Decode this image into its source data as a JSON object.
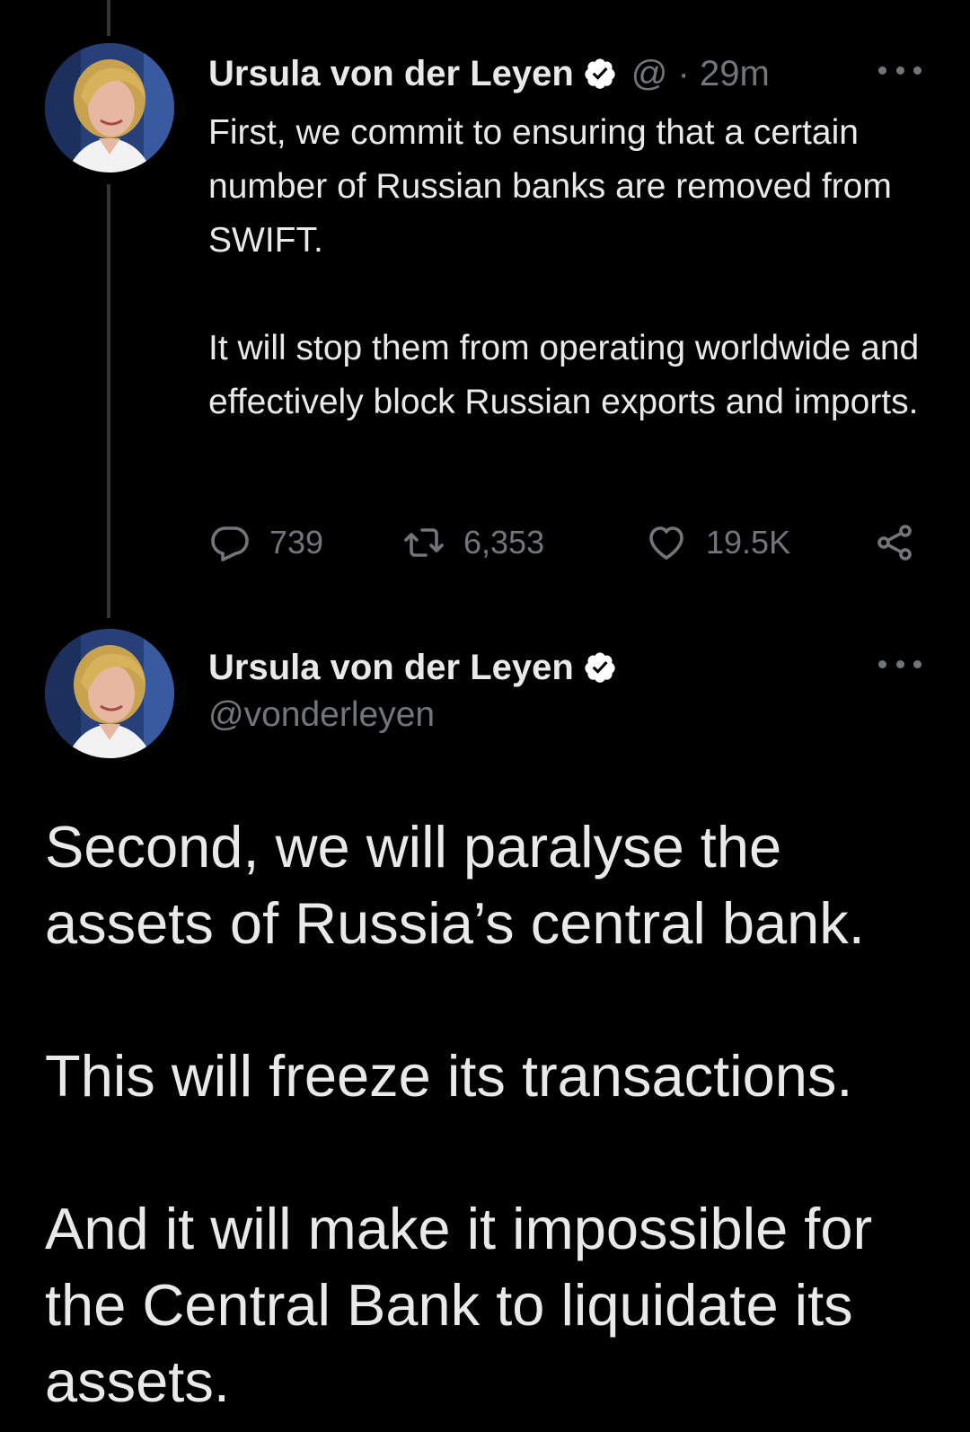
{
  "colors": {
    "background": "#000000",
    "primary_text": "#e7e9ea",
    "secondary_text": "#71767b",
    "thread_line": "#333639",
    "verified_badge": "#ffffff"
  },
  "tweet1": {
    "author": {
      "display_name": "Ursula von der Leyen",
      "verified_icon": "verified-badge-icon"
    },
    "meta": "@ · 29m",
    "paragraphs": [
      "First, we commit to ensuring that a certain number of Russian banks are removed from SWIFT.",
      "It will stop them from operating worldwide and effectively block Russian exports and imports."
    ],
    "actions": {
      "reply_count": "739",
      "retweet_count": "6,353",
      "like_count": "19.5K"
    }
  },
  "tweet2": {
    "author": {
      "display_name": "Ursula von der Leyen",
      "handle": "@vonderleyen",
      "verified_icon": "verified-badge-icon"
    },
    "paragraphs": [
      "Second, we will paralyse the assets of Russia’s central bank.",
      "This will freeze its transactions.",
      "And it will make it impossible for the Central Bank to liquidate its assets."
    ]
  }
}
